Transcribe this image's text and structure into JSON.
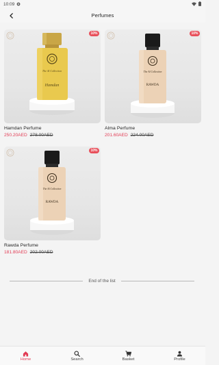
{
  "status": {
    "time": "10:09"
  },
  "appbar": {
    "title": "Perfumes"
  },
  "products": [
    {
      "name": "Hamdan Perfume",
      "price": "250.20AED",
      "old_price": "278.00AED",
      "discount": "10%",
      "label": "Hamdan"
    },
    {
      "name": "Alma Perfume",
      "price": "201.60AED",
      "old_price": "224.00AED",
      "discount": "10%",
      "label": "RAWDA"
    },
    {
      "name": "Rawda Perfume",
      "price": "181.80AED",
      "old_price": "202.00AED",
      "discount": "10%",
      "label": "RAWDA"
    }
  ],
  "end_of_list": "End of the list",
  "nav": {
    "home": "Home",
    "search": "Search",
    "basket": "Basket",
    "profile": "Profile"
  },
  "colors": {
    "accent": "#e23b54",
    "badge": "#e8505b"
  }
}
